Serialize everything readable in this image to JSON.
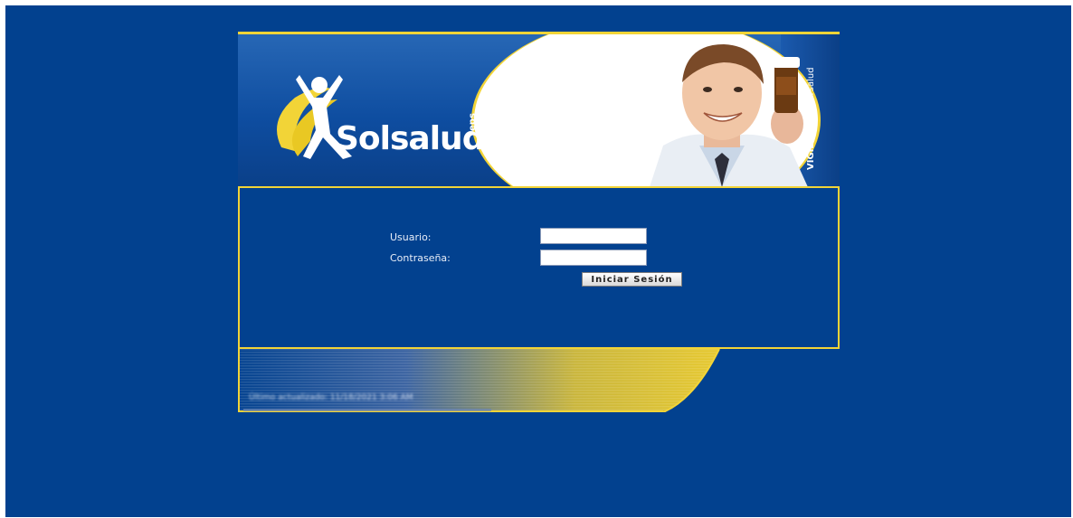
{
  "brand": {
    "name": "Solsalud",
    "suffix": "eps",
    "regulator_prefix": "VIGILADO",
    "regulator_name": "Supersalud"
  },
  "login": {
    "user_label": "Usuario:",
    "password_label": "Contraseña:",
    "user_value": "",
    "password_value": "",
    "submit_label": "Iniciar Sesión"
  },
  "footer": {
    "text": "Último actualizado: 11/18/2021 3:06 AM"
  },
  "colors": {
    "background": "#02418f",
    "accent": "#f2d437",
    "text": "#e8eef8"
  }
}
